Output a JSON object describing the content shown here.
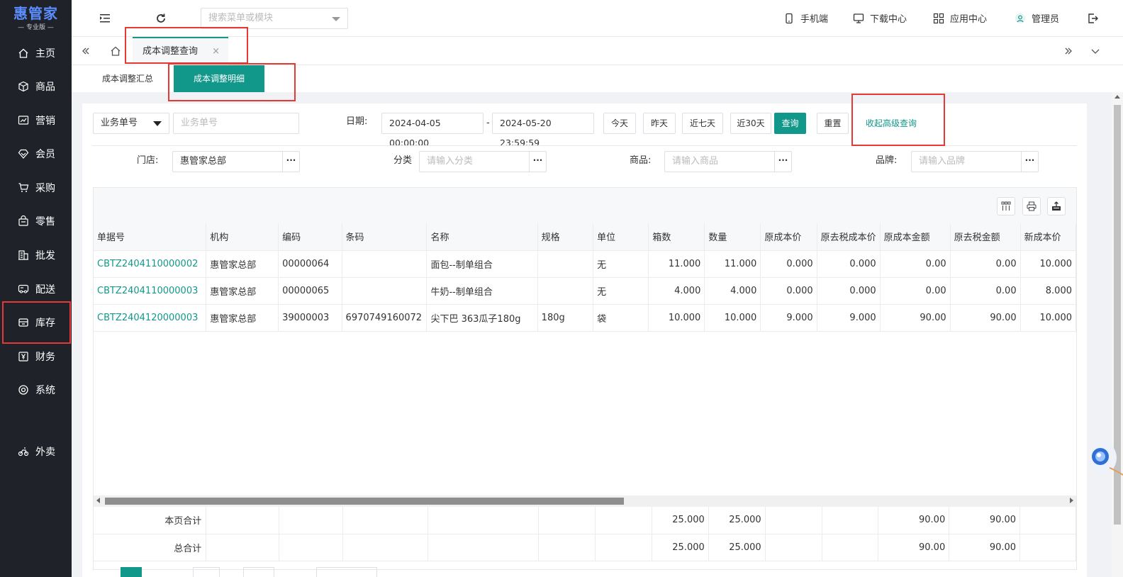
{
  "brand": {
    "name": "惠管家",
    "edition": "专业版",
    "color": "#5b8dff"
  },
  "sidebar": {
    "items": [
      {
        "label": "主页",
        "icon": "home-icon"
      },
      {
        "label": "商品",
        "icon": "box-icon"
      },
      {
        "label": "营销",
        "icon": "chart-icon"
      },
      {
        "label": "会员",
        "icon": "diamond-icon"
      },
      {
        "label": "采购",
        "icon": "cart-icon"
      },
      {
        "label": "零售",
        "icon": "bag-icon"
      },
      {
        "label": "批发",
        "icon": "building-icon"
      },
      {
        "label": "配送",
        "icon": "truck-icon"
      },
      {
        "label": "库存",
        "icon": "inventory-icon"
      },
      {
        "label": "财务",
        "icon": "yen-icon"
      },
      {
        "label": "系统",
        "icon": "settings-icon"
      },
      {
        "label": "外卖",
        "icon": "bike-icon"
      }
    ],
    "active": "库存"
  },
  "topbar": {
    "search_placeholder": "搜索菜单或模块",
    "mobile": "手机端",
    "download": "下载中心",
    "apps": "应用中心",
    "user": "管理员"
  },
  "tabs": {
    "active_label": "成本调整查询",
    "close": "×"
  },
  "subtabs": {
    "summary": "成本调整汇总",
    "detail": "成本调整明细"
  },
  "filters": {
    "doc_type": "业务单号",
    "doc_placeholder": "业务单号",
    "date_label": "日期:",
    "date_from": "2024-04-05 00:00:00",
    "date_sep": "-",
    "date_to": "2024-05-20 23:59:59",
    "today": "今天",
    "yesterday": "昨天",
    "last7": "近七天",
    "last30": "近30天",
    "search": "查询",
    "reset": "重置",
    "collapse": "收起高级查询",
    "store_label": "门店:",
    "store_value": "惠管家总部",
    "category_label": "分类",
    "category_placeholder": "请输入分类",
    "product_label": "商品:",
    "product_placeholder": "请输入商品",
    "brand_label": "品牌:",
    "brand_placeholder": "请输入品牌",
    "more": "···"
  },
  "table": {
    "columns": [
      "单据号",
      "机构",
      "编码",
      "条码",
      "名称",
      "规格",
      "单位",
      "箱数",
      "数量",
      "原成本价",
      "原去税成本价",
      "原成本金额",
      "原去税金额",
      "新成本价"
    ],
    "rows": [
      [
        "CBTZ2404110000002",
        "惠管家总部",
        "00000064",
        "",
        "面包--制单组合",
        "",
        "无",
        "11.000",
        "11.000",
        "0.000",
        "0.000",
        "0.00",
        "0.00",
        "10.000"
      ],
      [
        "CBTZ2404110000003",
        "惠管家总部",
        "00000065",
        "",
        "牛奶--制单组合",
        "",
        "无",
        "4.000",
        "4.000",
        "0.000",
        "0.000",
        "0.00",
        "0.00",
        "8.000"
      ],
      [
        "CBTZ2404120000003",
        "惠管家总部",
        "39000003",
        "6970749160072",
        "尖下巴 363瓜子180g",
        "180g",
        "袋",
        "10.000",
        "10.000",
        "9.000",
        "9.000",
        "90.00",
        "90.00",
        "10.000"
      ]
    ],
    "page_total_label": "本页合计",
    "grand_total_label": "总合计",
    "page_total": {
      "boxes": "25.000",
      "qty": "25.000",
      "orig_amount": "90.00",
      "orig_notax_amount": "90.00"
    },
    "grand_total": {
      "boxes": "25.000",
      "qty": "25.000",
      "orig_amount": "90.00",
      "orig_notax_amount": "90.00"
    }
  },
  "colors": {
    "primary": "#12978b",
    "sidebar": "#1f2329",
    "highlight": "#e53935"
  }
}
